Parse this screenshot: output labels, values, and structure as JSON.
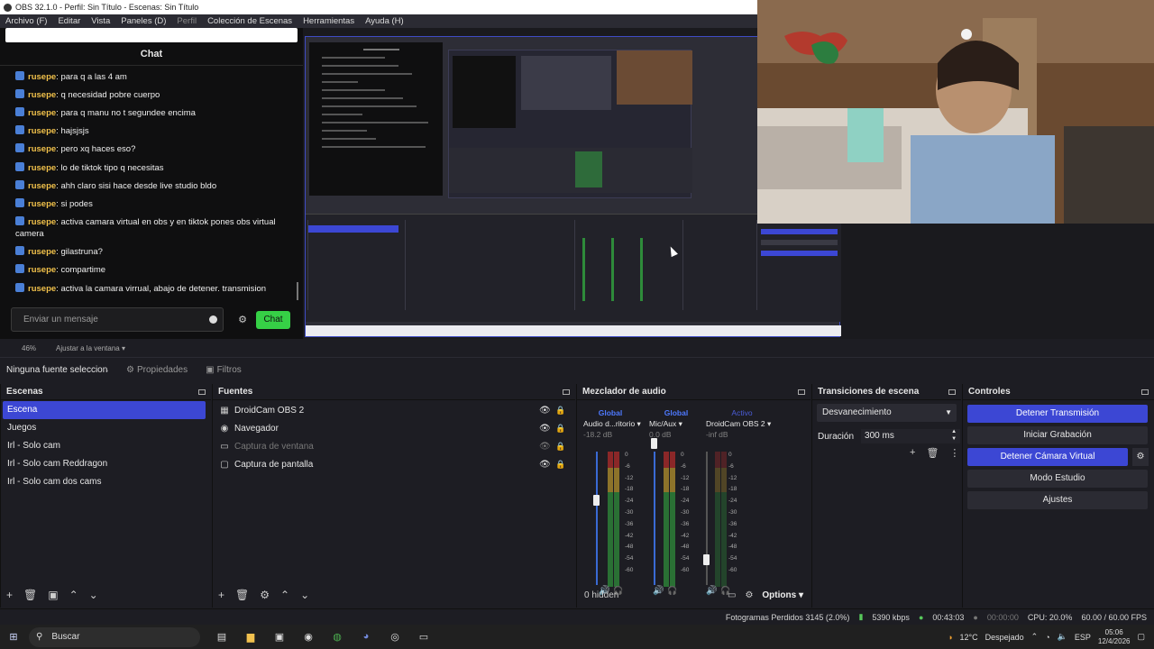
{
  "window": {
    "title": "OBS 32.1.0 - Perfil: Sin Título - Escenas: Sin Título"
  },
  "menu": [
    {
      "label": "Archivo (F)",
      "dim": false
    },
    {
      "label": "Editar",
      "dim": false
    },
    {
      "label": "Vista",
      "dim": false
    },
    {
      "label": "Paneles (D)",
      "dim": false
    },
    {
      "label": "Perfil",
      "dim": true
    },
    {
      "label": "Colección de Escenas",
      "dim": false
    },
    {
      "label": "Herramientas",
      "dim": false
    },
    {
      "label": "Ayuda (H)",
      "dim": false
    }
  ],
  "chat": {
    "title": "Chat",
    "messages": [
      {
        "user": "rusepe",
        "text": "para q a las 4 am"
      },
      {
        "user": "rusepe",
        "text": "q necesidad pobre cuerpo"
      },
      {
        "user": "rusepe",
        "text": "para q manu no t segundee encima"
      },
      {
        "user": "rusepe",
        "text": "hajsjsjs"
      },
      {
        "user": "rusepe",
        "text": "pero xq haces eso?"
      },
      {
        "user": "rusepe",
        "text": "lo de tiktok tipo q necesitas"
      },
      {
        "user": "rusepe",
        "text": "ahh claro sisi hace desde live studio bldo"
      },
      {
        "user": "rusepe",
        "text": "si podes"
      },
      {
        "user": "rusepe",
        "text": "activa camara virtual en obs y en tiktok pones obs virtual camera"
      },
      {
        "user": "rusepe",
        "text": "gilastruna?"
      },
      {
        "user": "rusepe",
        "text": "compartime"
      },
      {
        "user": "rusepe",
        "text": "activa la camara virrual, abajo de detener. transmision"
      }
    ],
    "input_placeholder": "Enviar un mensaje",
    "send_label": "Chat"
  },
  "preview": {
    "zoom": "46%",
    "fit_label": "Ajustar a la ventana"
  },
  "source_toolbar": {
    "no_source": "Ninguna fuente seleccionada",
    "properties": "Propiedades",
    "filters": "Filtros"
  },
  "scenes": {
    "title": "Escenas",
    "items": [
      "Escena",
      "Juegos",
      "Irl - Solo cam",
      "Irl - Solo cam Reddragon",
      "Irl - Solo cam dos cams"
    ],
    "active_index": 0
  },
  "sources": {
    "title": "Fuentes",
    "items": [
      {
        "label": "DroidCam OBS 2",
        "icon": "camera-icon",
        "visible": true
      },
      {
        "label": "Navegador",
        "icon": "globe-icon",
        "visible": true
      },
      {
        "label": "Captura de ventana",
        "icon": "window-icon",
        "visible": false
      },
      {
        "label": "Captura de pantalla",
        "icon": "monitor-icon",
        "visible": true
      }
    ]
  },
  "mixer": {
    "title": "Mezclador de audio",
    "channels": [
      {
        "tag": "Global",
        "name": "Audio d...ritorio",
        "db": "-18.2 dB"
      },
      {
        "tag": "Global",
        "name": "Mic/Aux",
        "db": "0.0 dB"
      },
      {
        "tag": "Activo",
        "name": "DroidCam OBS 2",
        "db": "-inf dB"
      }
    ],
    "scale": [
      "0",
      "-6",
      "-12",
      "-18",
      "-24",
      "-30",
      "-36",
      "-42",
      "-48",
      "-54",
      "-60"
    ],
    "hidden": "0 hidden",
    "options": "Options"
  },
  "transitions": {
    "title": "Transiciones de escena",
    "selected": "Desvanecimiento",
    "duration_label": "Duración",
    "duration_value": "300 ms"
  },
  "controls": {
    "title": "Controles",
    "buttons": [
      "Detener Transmisión",
      "Iniciar Grabación",
      "Detener Cámara Virtual",
      "Modo Estudio",
      "Ajustes"
    ]
  },
  "status": {
    "dropped": "Fotogramas Perdidos 3145 (2.0%)",
    "bitrate": "5390 kbps",
    "stream_time": "00:43:03",
    "rec_time": "00:00:00",
    "cpu": "CPU: 20.0%",
    "fps": "60.00 / 60.00 FPS"
  },
  "taskbar": {
    "search": "Buscar",
    "weather_temp": "12°C",
    "weather_text": "Despejado",
    "lang": "ESP",
    "time": "05:06",
    "date": "12/4/2026"
  },
  "colors": {
    "accent": "#3c47d4",
    "chat_send": "#36d046",
    "username": "#f0c04a"
  }
}
